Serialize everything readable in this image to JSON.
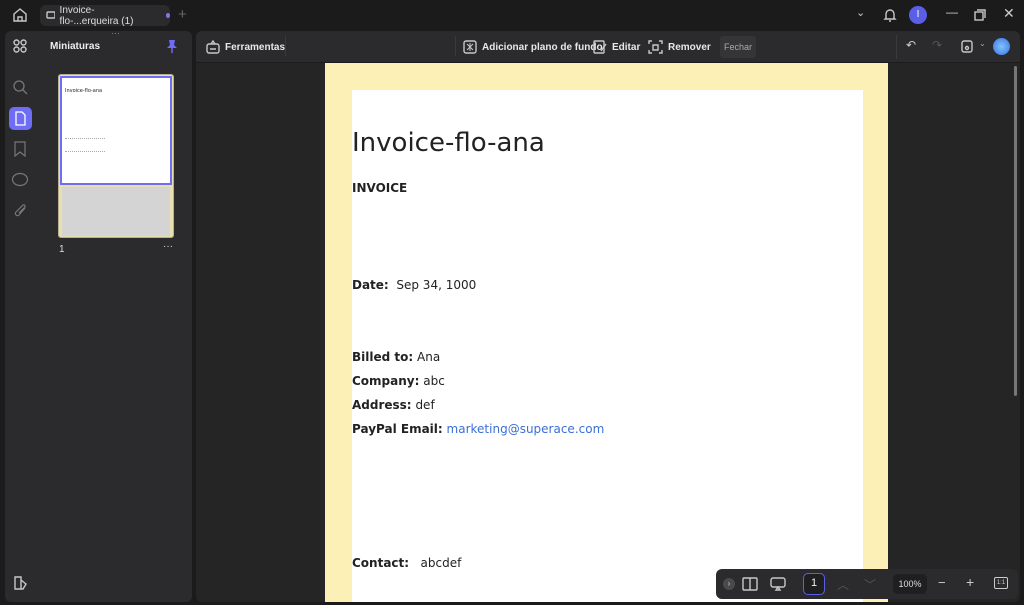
{
  "tab": {
    "title": "Invoice-flo-...erqueira (1)"
  },
  "panel": {
    "title": "Miniaturas",
    "page_number": "1"
  },
  "toolbar": {
    "tools": "Ferramentas",
    "add_background": "Adicionar plano de fundo",
    "edit": "Editar",
    "remove": "Remover",
    "close": "Fechar"
  },
  "document": {
    "title": "Invoice-flo-ana",
    "heading": "INVOICE",
    "date_label": "Date:",
    "date_value": "Sep 34, 1000",
    "billed_label": "Billed to:",
    "billed_value": "Ana",
    "company_label": "Company:",
    "company_value": "abc",
    "address_label": "Address:",
    "address_value": "def",
    "email_label": "PayPal Email:",
    "email_value": "marketing@superace.com",
    "contact_label": "Contact:",
    "contact_value": "abcdef"
  },
  "footer": {
    "page_input": "1",
    "zoom": "100%",
    "fit": "1:1"
  },
  "user": {
    "avatar": "I"
  },
  "colors": {
    "accent": "#6f6cf6",
    "link": "#3b6fd6",
    "page_bg": "#fdf0b6"
  }
}
